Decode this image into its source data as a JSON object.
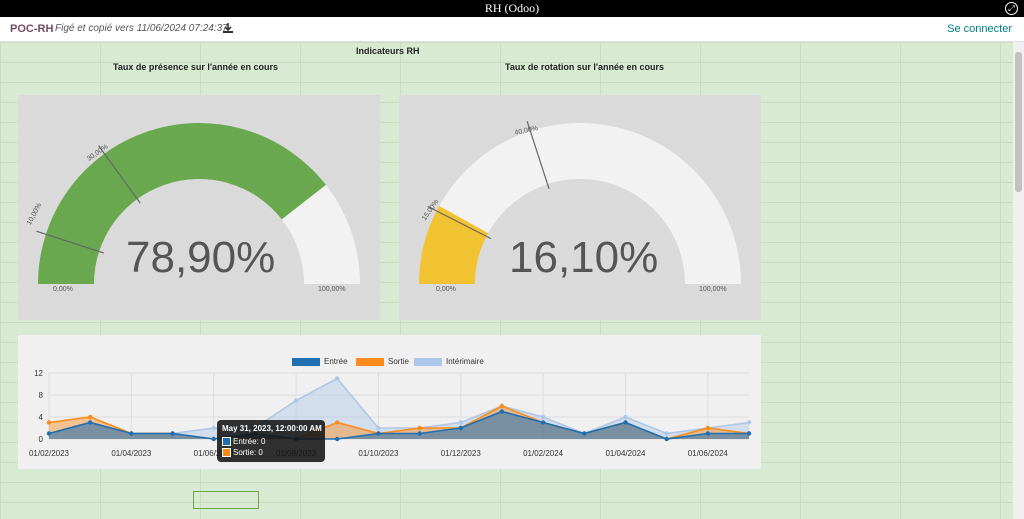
{
  "window": {
    "title": "RH (Odoo)"
  },
  "topbar": {
    "brand": "POC-RH",
    "frozen_text": "Figé et copié vers 11/06/2024 07:24:37",
    "login": "Se connecter"
  },
  "sheet": {
    "title": "Indicateurs RH",
    "gauge1_heading": "Taux de présence sur l'année en cours",
    "gauge2_heading": "Taux de rotation sur l'année en cours"
  },
  "gauges": [
    {
      "value_label": "78,90%",
      "value": 78.9,
      "color": "#6aa84f",
      "ticks": {
        "min": "0,00%",
        "max": "100,00%",
        "t1": "10,00%",
        "t2": "30,00%"
      },
      "tick_values": [
        10,
        30
      ]
    },
    {
      "value_label": "16,10%",
      "value": 16.1,
      "color": "#f1c232",
      "ticks": {
        "min": "0,00%",
        "max": "100,00%",
        "t1": "15,00%",
        "t2": "40,00%"
      },
      "tick_values": [
        15,
        40
      ]
    }
  ],
  "chart_data": {
    "type": "area",
    "x": [
      "01/02/2023",
      "01/03/2023",
      "01/04/2023",
      "01/05/2023",
      "01/06/2023",
      "01/07/2023",
      "01/08/2023",
      "01/09/2023",
      "01/10/2023",
      "01/11/2023",
      "01/12/2023",
      "01/01/2024",
      "01/02/2024",
      "01/03/2024",
      "01/04/2024",
      "01/05/2024",
      "01/06/2024",
      "01/07/2024"
    ],
    "xtick_labels": [
      "01/02/2023",
      "01/04/2023",
      "01/06/2023",
      "01/08/2023",
      "01/10/2023",
      "01/12/2023",
      "01/02/2024",
      "01/04/2024",
      "01/06/2024"
    ],
    "ytick_labels": [
      "0",
      "4",
      "8",
      "12"
    ],
    "ylim": [
      0,
      12
    ],
    "series": [
      {
        "name": "Entrée",
        "color": "#1f6fb2",
        "values": [
          1,
          3,
          1,
          1,
          0,
          1,
          0,
          0,
          1,
          1,
          2,
          5,
          3,
          1,
          3,
          0,
          1,
          1
        ]
      },
      {
        "name": "Sortie",
        "color": "#fb8c1c",
        "values": [
          3,
          4,
          1,
          1,
          0,
          1,
          0,
          3,
          1,
          2,
          2,
          6,
          3,
          1,
          3,
          0,
          2,
          1
        ]
      },
      {
        "name": "Intérimaire",
        "color": "#aec7e8",
        "values": [
          1,
          3,
          1,
          1,
          2,
          2,
          7,
          11,
          2,
          2,
          3,
          6,
          4,
          1,
          4,
          1,
          2,
          3
        ]
      }
    ],
    "legend_position": "top",
    "grid": true
  },
  "tooltip": {
    "title": "May 31, 2023, 12:00:00 AM",
    "entree": "Entrée: 0",
    "sortie": "Sortie: 0"
  },
  "icons": {
    "download": "download-icon",
    "window": "restore-icon"
  }
}
